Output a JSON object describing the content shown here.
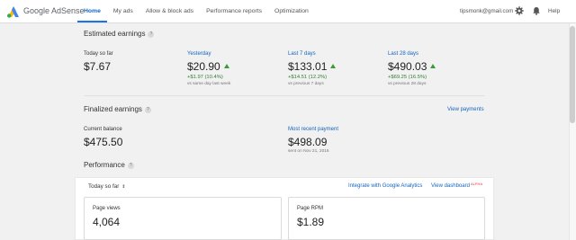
{
  "header": {
    "brand": "Google AdSense",
    "nav": [
      "Home",
      "My ads",
      "Allow & block ads",
      "Performance reports",
      "Optimization"
    ],
    "active_nav": "Home",
    "email": "tipsmonk@gmail.com",
    "help_label": "Help"
  },
  "estimated": {
    "title": "Estimated earnings",
    "help_icon": "?",
    "today": {
      "label": "Today so far",
      "value": "$7.67"
    },
    "yesterday": {
      "label": "Yesterday",
      "value": "$20.90",
      "change": "+$1.97 (10.4%)",
      "compare": "vs same day last week"
    },
    "last7": {
      "label": "Last 7 days",
      "value": "$133.01",
      "change": "+$14.51 (12.2%)",
      "compare": "vs previous 7 days"
    },
    "last28": {
      "label": "Last 28 days",
      "value": "$490.03",
      "change": "+$69.25 (16.5%)",
      "compare": "vs previous 28 days"
    }
  },
  "finalized": {
    "title": "Finalized earnings",
    "help_icon": "?",
    "view_payments": "View payments",
    "balance": {
      "label": "Current balance",
      "value": "$475.50"
    },
    "payment": {
      "label": "Most recent payment",
      "value": "$498.09",
      "sent": "sent on Nov 21, 2016"
    }
  },
  "performance": {
    "title": "Performance",
    "help_icon": "?",
    "range": "Today so far",
    "range_arrows": "⇕",
    "integrate_link": "Integrate with Google Analytics",
    "dashboard_link": "View dashboard",
    "dashboard_badge": "ALPHA",
    "cards": [
      {
        "label": "Page views",
        "value": "4,064"
      },
      {
        "label": "Page RPM",
        "value": "$1.89"
      }
    ]
  },
  "colors": {
    "accent": "#1a73e8",
    "link": "#1565c0",
    "positive": "#3c9a3c",
    "background": "#f1f1f1"
  },
  "icons": [
    "adsense-logo-icon",
    "gear-icon",
    "bell-icon",
    "help-circle-icon",
    "up-arrow-icon",
    "sort-arrows-icon"
  ]
}
